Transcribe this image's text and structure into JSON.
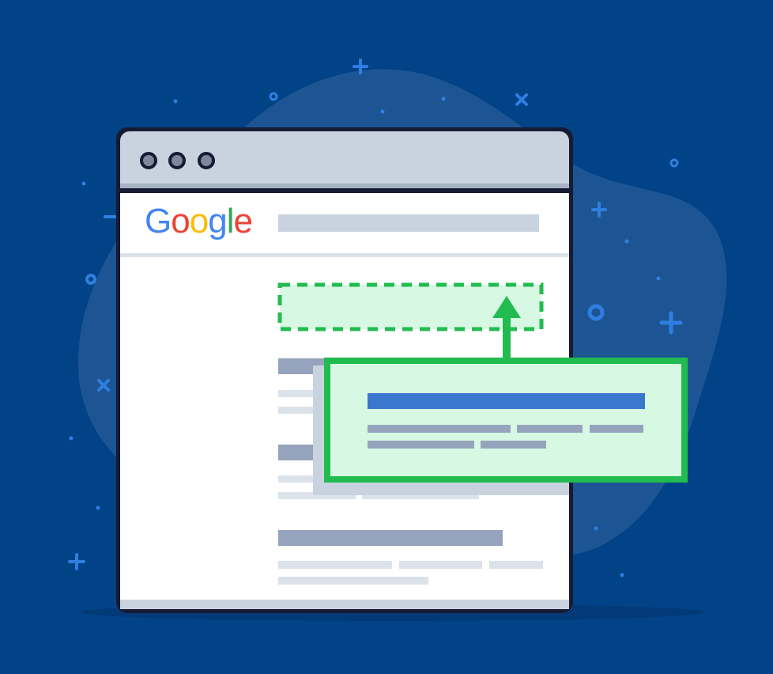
{
  "logo_text": "Google",
  "colors": {
    "background": "#024287",
    "blob": "#1d5594",
    "accent_blue": "#2f7fe0",
    "frame": "#161b33",
    "titlebar": "#c9d3e0",
    "window_bg": "#ffffff",
    "bar_dark": "#95a4bc",
    "bar_light": "#dce2ea",
    "promo_green": "#22bb4f",
    "promo_fill": "#d7f8e3",
    "promo_title_bar": "#3a78cd",
    "logo_blue": "#4285F4",
    "logo_red": "#EA4335",
    "logo_yellow": "#FBBC05",
    "logo_green": "#34A853"
  },
  "icons": [
    "window-dot-icon",
    "up-arrow-icon",
    "plus-icon",
    "cross-icon",
    "ring-icon"
  ]
}
